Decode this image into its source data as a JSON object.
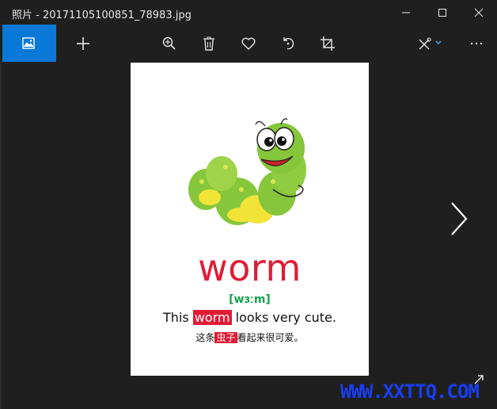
{
  "window": {
    "title": "照片 - 20171105100851_78983.jpg",
    "minimize_icon": "minimize-icon",
    "maximize_icon": "maximize-icon",
    "close_icon": "close-icon"
  },
  "toolbar": {
    "items": [
      {
        "name": "photos-icon",
        "active": true
      },
      {
        "name": "add-icon"
      },
      {
        "name": "zoom-in-icon"
      },
      {
        "name": "delete-icon"
      },
      {
        "name": "favorite-icon"
      },
      {
        "name": "rotate-icon"
      },
      {
        "name": "crop-icon"
      },
      {
        "name": "edit-draw-icon"
      },
      {
        "name": "more-icon"
      }
    ]
  },
  "photo": {
    "word": "worm",
    "phonetic": "[wɜːm]",
    "sentence_before": "This ",
    "sentence_highlight": "worm",
    "sentence_after": " looks very cute.",
    "cn_before": "这条",
    "cn_highlight": "虫子",
    "cn_after": "看起来很可爱。"
  },
  "navigation": {
    "next_icon": "chevron-right-icon",
    "expand_icon": "expand-icon"
  },
  "watermark": "WWW.XXTTQ.COM",
  "colors": {
    "accent": "#0a78d7",
    "word": "#e11b35",
    "phonetic": "#13a34a",
    "background": "#1f1f1f"
  }
}
